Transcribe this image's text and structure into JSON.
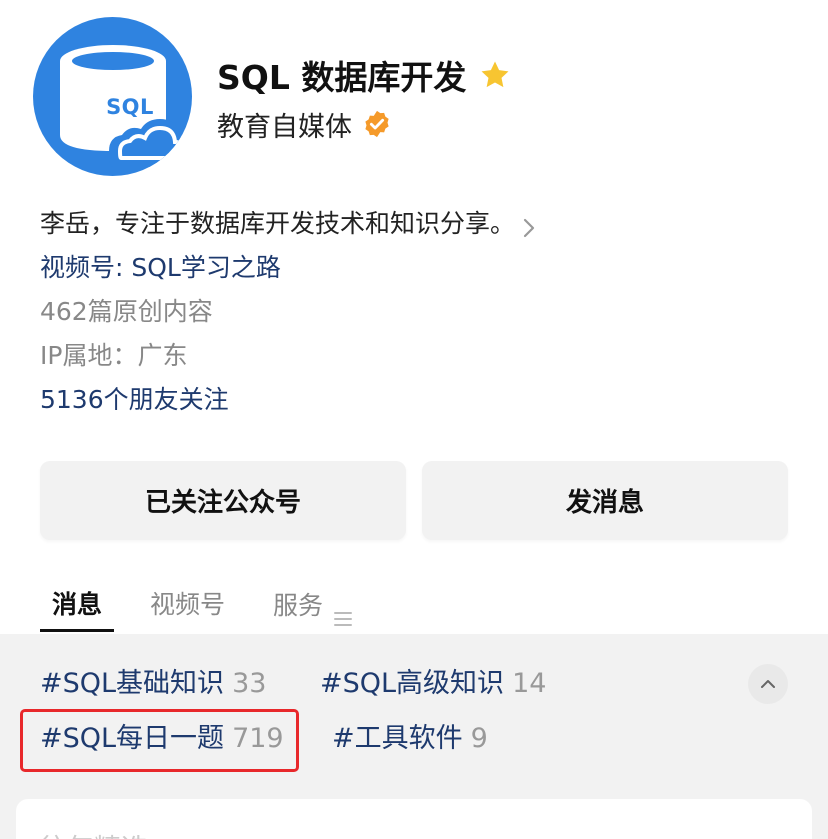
{
  "profile": {
    "avatar_text": "SQL",
    "name": "SQL 数据库开发",
    "type": "教育自媒体",
    "star_icon": "star-icon",
    "verified_icon": "verified-badge-icon"
  },
  "info": {
    "bio": "李岳，专注于数据库开发技术和知识分享。",
    "channel": "视频号: SQL学习之路",
    "articles": "462篇原创内容",
    "ip": "IP属地：广东",
    "followers": "5136个朋友关注"
  },
  "actions": {
    "follow_label": "已关注公众号",
    "message_label": "发消息"
  },
  "tabs": [
    {
      "label": "消息",
      "active": true
    },
    {
      "label": "视频号",
      "active": false
    },
    {
      "label": "服务",
      "active": false
    }
  ],
  "topics": [
    {
      "label": "#SQL基础知识",
      "count": "33"
    },
    {
      "label": "#SQL高级知识",
      "count": "14"
    },
    {
      "label": "#SQL每日一题",
      "count": "719",
      "highlighted": true
    },
    {
      "label": "#工具软件",
      "count": "9"
    }
  ],
  "card": {
    "partial_text": "往年精选"
  },
  "colors": {
    "accent_blue": "#2f83e0",
    "link_navy": "#1e3a6e",
    "highlight_red": "#e8282b",
    "star_yellow": "#f7c531",
    "badge_orange": "#f59a2a"
  }
}
